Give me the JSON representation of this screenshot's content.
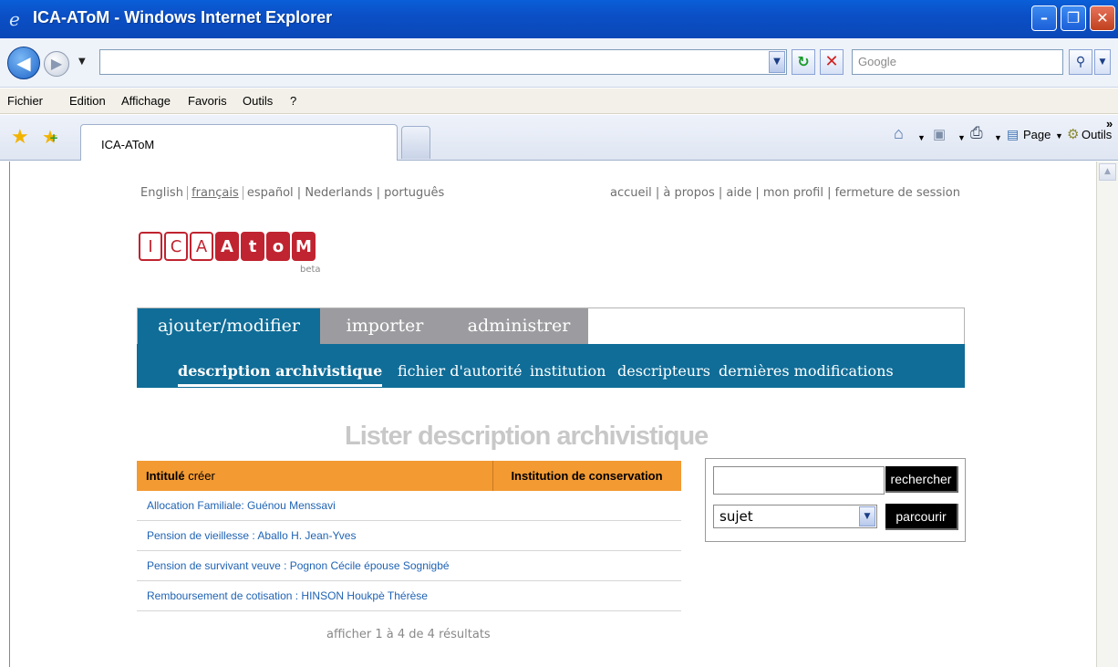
{
  "window": {
    "title": "ICA-AToM - Windows Internet Explorer",
    "min": "–",
    "max": "❐",
    "close": "✕"
  },
  "address": {
    "value": "",
    "search_placeholder": "Google"
  },
  "menu": [
    "Fichier",
    "Edition",
    "Affichage",
    "Favoris",
    "Outils",
    "?"
  ],
  "tab": {
    "label": "ICA-AToM"
  },
  "toolbar": {
    "page": "Page",
    "tools": "Outils",
    "more": "»"
  },
  "site": {
    "languages": [
      "English",
      "français",
      "español",
      "Nederlands",
      "português"
    ],
    "top_links": [
      "accueil",
      "à propos",
      "aide",
      "mon profil",
      "fermeture de session"
    ],
    "logo_letters": [
      "I",
      "C",
      "A",
      "A",
      "t",
      "o",
      "M"
    ],
    "logo_beta": "beta",
    "main_tabs": [
      "ajouter/modifier",
      "importer",
      "administrer"
    ],
    "sub_nav": [
      "description archivistique",
      "fichier d'autorité",
      "institution",
      "descripteurs",
      "dernières modifications"
    ],
    "list_title": "Lister description archivistique",
    "table": {
      "col1_bold": "Intitulé",
      "col1_rest": " créer",
      "col2": "Institution de conservation",
      "rows": [
        "Allocation Familiale: Guénou Menssavi",
        "Pension de vieillesse : Aballo H. Jean-Yves",
        "Pension de survivant veuve : Pognon Cécile épouse Sognigbé",
        "Remboursement de cotisation : HINSON Houkpè Thérèse"
      ]
    },
    "results": "afficher 1 à 4 de 4 résultats",
    "search": {
      "button": "rechercher",
      "select_value": "sujet",
      "browse_button": "parcourir"
    }
  }
}
